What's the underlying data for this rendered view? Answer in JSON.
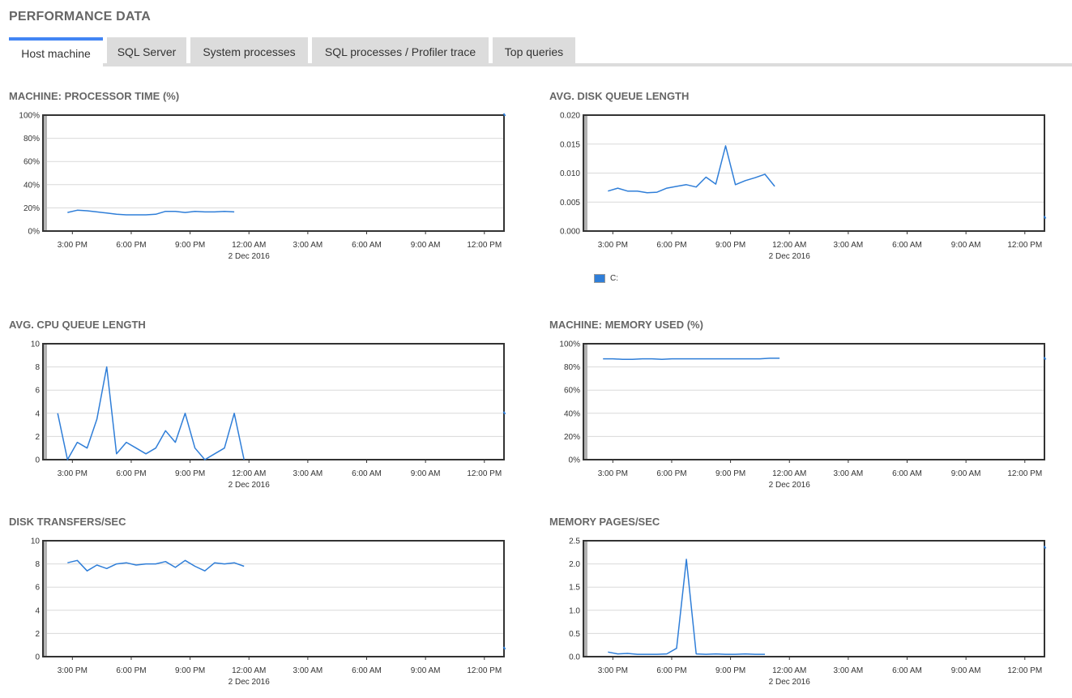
{
  "page": {
    "title": "PERFORMANCE DATA"
  },
  "tabs": [
    {
      "label": "Host machine",
      "active": true
    },
    {
      "label": "SQL Server",
      "active": false
    },
    {
      "label": "System processes",
      "active": false
    },
    {
      "label": "SQL processes / Profiler trace",
      "active": false
    },
    {
      "label": "Top queries",
      "active": false
    }
  ],
  "colors": {
    "series": "#2f7ed8",
    "tab_accent": "#4285f4"
  },
  "x_axis": {
    "ticks": [
      "3:00 PM",
      "6:00 PM",
      "9:00 PM",
      "12:00 AM",
      "3:00 AM",
      "6:00 AM",
      "9:00 AM",
      "12:00 PM"
    ],
    "date_label": "2 Dec 2016",
    "date_tick_index": 3
  },
  "chart_data": [
    {
      "id": "processor",
      "type": "line",
      "title": "MACHINE: PROCESSOR TIME (%)",
      "yticks": [
        "0%",
        "20%",
        "40%",
        "60%",
        "80%",
        "100%"
      ],
      "ylim": [
        0,
        100
      ],
      "x_hours": [
        14.75,
        15.25,
        15.75,
        16.25,
        16.75,
        17.25,
        17.75,
        18.25,
        18.75,
        19.25,
        19.75,
        20.25,
        20.75,
        21.25,
        21.75,
        22.25,
        22.75,
        23.25
      ],
      "values": [
        16,
        18,
        17.5,
        16.5,
        15.5,
        14.5,
        14,
        14,
        14,
        14.5,
        17,
        17,
        16,
        17,
        16.5,
        16.5,
        17,
        16.5
      ],
      "edge_value": 100,
      "legend": null
    },
    {
      "id": "disk_queue",
      "type": "line",
      "title": "AVG. DISK QUEUE LENGTH",
      "yticks": [
        "0.000",
        "0.005",
        "0.010",
        "0.015",
        "0.020"
      ],
      "ylim": [
        0,
        0.02
      ],
      "x_hours": [
        14.75,
        15.25,
        15.75,
        16.25,
        16.75,
        17.25,
        17.75,
        18.25,
        18.75,
        19.25,
        19.75,
        20.25,
        20.75,
        21.25,
        21.75,
        22.25,
        22.75,
        23.25
      ],
      "values": [
        0.0069,
        0.0074,
        0.0069,
        0.0069,
        0.0066,
        0.0067,
        0.0074,
        0.0077,
        0.008,
        0.0076,
        0.0093,
        0.0081,
        0.0147,
        0.008,
        0.0087,
        0.0092,
        0.0098,
        0.0077
      ],
      "edge_value": 0.0023,
      "legend": "C:"
    },
    {
      "id": "cpu_queue",
      "type": "line",
      "title": "AVG. CPU QUEUE LENGTH",
      "yticks": [
        "0",
        "2",
        "4",
        "6",
        "8",
        "10"
      ],
      "ylim": [
        0,
        10
      ],
      "x_hours": [
        14.25,
        14.75,
        15.25,
        15.75,
        16.25,
        16.75,
        17.25,
        17.75,
        18.25,
        18.75,
        19.25,
        19.75,
        20.25,
        20.75,
        21.25,
        21.75,
        22.25,
        22.75,
        23.25
      ],
      "values": [
        4,
        0,
        1.5,
        1,
        3.5,
        8,
        0.5,
        1.5,
        1,
        0.5,
        1,
        2.5,
        1.5,
        4,
        1,
        0,
        0.5,
        1,
        4
      ],
      "tail_hour": 23.75,
      "tail_value": 0,
      "edge_value": 4,
      "legend": null
    },
    {
      "id": "memory_used",
      "type": "line",
      "title": "MACHINE: MEMORY USED (%)",
      "yticks": [
        "0%",
        "20%",
        "40%",
        "60%",
        "80%",
        "100%"
      ],
      "ylim": [
        0,
        100
      ],
      "x_hours": [
        14.5,
        15.0,
        15.5,
        16.0,
        16.5,
        17.0,
        17.5,
        18.0,
        18.5,
        19.0,
        19.5,
        20.0,
        20.5,
        21.0,
        21.5,
        22.0,
        22.5,
        23.0,
        23.5
      ],
      "values": [
        87,
        87,
        86.5,
        86.5,
        87,
        87,
        86.5,
        87,
        87,
        87,
        87,
        87,
        87,
        87,
        87,
        87,
        87,
        87.5,
        87.5
      ],
      "edge_value": 87,
      "legend": null
    },
    {
      "id": "disk_transfers",
      "type": "line",
      "title": "DISK TRANSFERS/SEC",
      "yticks": [
        "0",
        "2",
        "4",
        "6",
        "8",
        "10"
      ],
      "ylim": [
        0,
        10
      ],
      "x_hours": [
        14.75,
        15.25,
        15.75,
        16.25,
        16.75,
        17.25,
        17.75,
        18.25,
        18.75,
        19.25,
        19.75,
        20.25,
        20.75,
        21.25,
        21.75,
        22.25,
        22.75,
        23.25,
        23.75
      ],
      "values": [
        8.1,
        8.3,
        7.4,
        7.9,
        7.6,
        8.0,
        8.1,
        7.9,
        8.0,
        8.0,
        8.2,
        7.7,
        8.3,
        7.8,
        7.4,
        8.1,
        8.0,
        8.1,
        7.8
      ],
      "edge_value": 0.7,
      "legend": null
    },
    {
      "id": "memory_pages",
      "type": "line",
      "title": "MEMORY PAGES/SEC",
      "yticks": [
        "0.0",
        "0.5",
        "1.0",
        "1.5",
        "2.0",
        "2.5"
      ],
      "ylim": [
        0,
        2.5
      ],
      "x_hours": [
        14.75,
        15.25,
        15.75,
        16.25,
        16.75,
        17.25,
        17.75,
        18.25,
        18.75,
        19.25,
        19.75,
        20.25,
        20.75,
        21.25,
        21.75,
        22.25,
        22.75
      ],
      "values": [
        0.1,
        0.06,
        0.07,
        0.05,
        0.05,
        0.05,
        0.06,
        0.18,
        2.1,
        0.06,
        0.05,
        0.06,
        0.05,
        0.05,
        0.06,
        0.05,
        0.05
      ],
      "edge_value": 2.35,
      "legend": null
    }
  ]
}
